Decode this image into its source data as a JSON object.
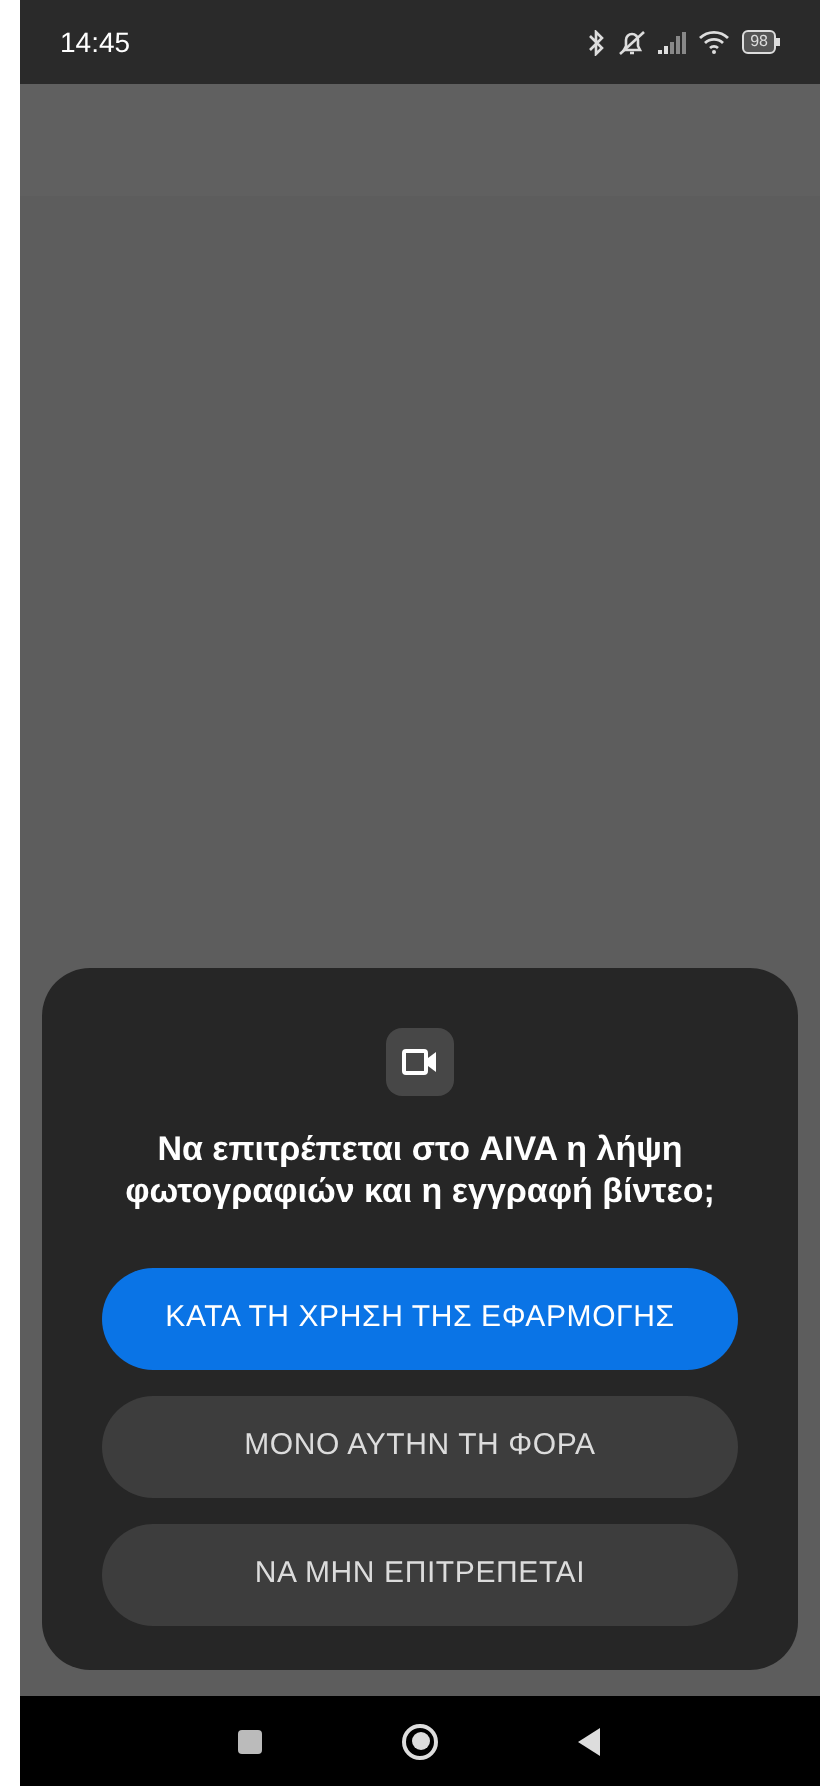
{
  "status_bar": {
    "time": "14:45",
    "battery": "98"
  },
  "dialog": {
    "message": "Να επιτρέπεται στο AIVA η λήψη φωτογραφιών και η εγγραφή βίντεο;",
    "buttons": [
      {
        "label": "ΚΑΤΑ ΤΗ ΧΡΗΣΗ ΤΗΣ ΕΦΑΡΜΟΓΗΣ",
        "kind": "primary"
      },
      {
        "label": "ΜΟΝΟ ΑΥΤΗΝ ΤΗ ΦΟΡΑ",
        "kind": "secondary"
      },
      {
        "label": "ΝΑ ΜΗΝ ΕΠΙΤΡΕΠΕΤΑΙ",
        "kind": "secondary"
      }
    ]
  }
}
